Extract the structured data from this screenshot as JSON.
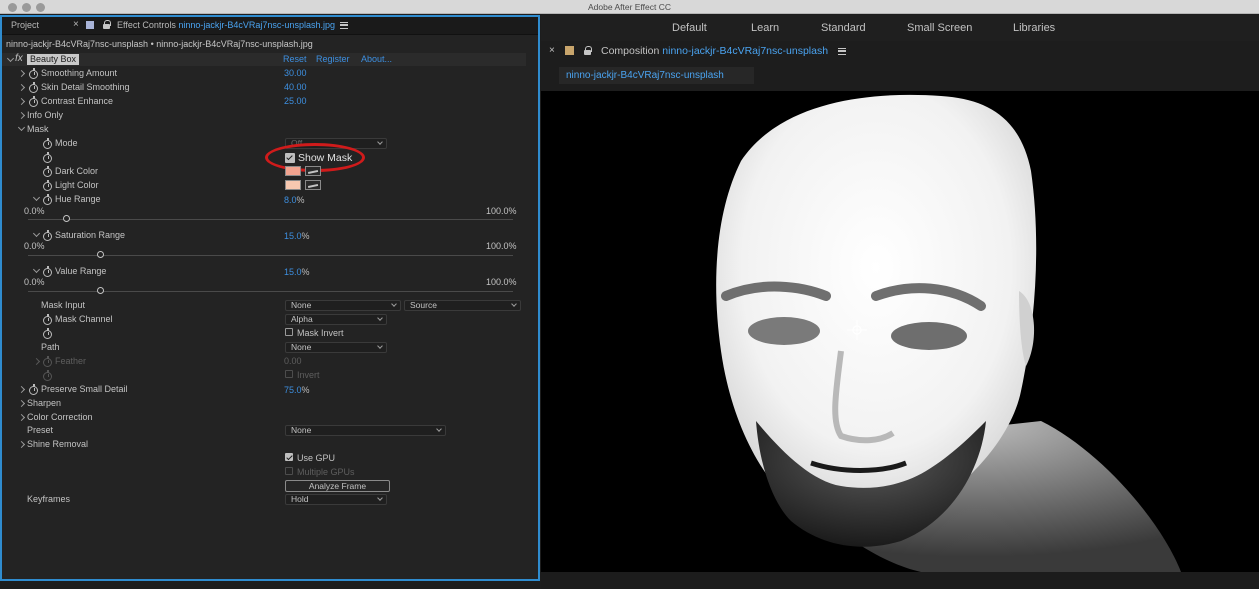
{
  "app": {
    "title": "Adobe After Effect CC"
  },
  "left_tabs": {
    "project": "Project",
    "close_glyph": "×",
    "effect_controls_prefix": "Effect Controls",
    "effect_controls_file": "ninno-jackjr-B4cVRaj7nsc-unsplash.jpg"
  },
  "breadcrumb": "ninno-jackjr-B4cVRaj7nsc-unsplash • ninno-jackjr-B4cVRaj7nsc-unsplash.jpg",
  "effect": {
    "fx_glyph": "fx",
    "name": "Beauty Box",
    "reset": "Reset",
    "register": "Register",
    "about": "About..."
  },
  "props": {
    "smoothing_amount": {
      "label": "Smoothing Amount",
      "value": "30.00"
    },
    "skin_detail": {
      "label": "Skin Detail Smoothing",
      "value": "40.00"
    },
    "contrast": {
      "label": "Contrast Enhance",
      "value": "25.00"
    },
    "info_only": {
      "label": "Info Only"
    },
    "mask": {
      "label": "Mask"
    },
    "mode": {
      "label": "Mode",
      "value": "Off"
    },
    "show_mask": {
      "label": "Show Mask",
      "checked": true
    },
    "dark_color": {
      "label": "Dark Color",
      "color": "#f2a38f"
    },
    "light_color": {
      "label": "Light Color",
      "color": "#f7c8b0"
    },
    "hue_range": {
      "label": "Hue Range",
      "value": "8.0",
      "unit": "%",
      "min": "0.0%",
      "max": "100.0%",
      "level": 0.08
    },
    "saturation_range": {
      "label": "Saturation Range",
      "value": "15.0",
      "unit": "%",
      "min": "0.0%",
      "max": "100.0%",
      "level": 0.15
    },
    "value_range": {
      "label": "Value Range",
      "value": "15.0",
      "unit": "%",
      "min": "0.0%",
      "max": "100.0%",
      "level": 0.15
    },
    "mask_input": {
      "label": "Mask Input",
      "value": "None",
      "source": "Source"
    },
    "mask_channel": {
      "label": "Mask Channel",
      "value": "Alpha"
    },
    "mask_invert": {
      "label": "Mask Invert",
      "checked": false
    },
    "path": {
      "label": "Path",
      "value": "None"
    },
    "feather": {
      "label": "Feather",
      "value": "0.00"
    },
    "invert": {
      "label": "Invert"
    },
    "preserve": {
      "label": "Preserve Small Detail",
      "value": "75.0",
      "unit": "%"
    },
    "sharpen": {
      "label": "Sharpen"
    },
    "color_correction": {
      "label": "Color Correction"
    },
    "preset": {
      "label": "Preset",
      "value": "None"
    },
    "shine_removal": {
      "label": "Shine Removal"
    },
    "use_gpu": {
      "label": "Use GPU",
      "checked": true
    },
    "multiple_gpus": {
      "label": "Multiple GPUs"
    },
    "analyze_frame": {
      "label": "Analyze Frame"
    },
    "keyframes": {
      "label": "Keyframes",
      "value": "Hold"
    }
  },
  "workspaces": [
    "Default",
    "Learn",
    "Standard",
    "Small Screen",
    "Libraries"
  ],
  "composition": {
    "close_glyph": "×",
    "prefix": "Composition",
    "name": "ninno-jackjr-B4cVRaj7nsc-unsplash",
    "tab_label": "ninno-jackjr-B4cVRaj7nsc-unsplash"
  },
  "colors": {
    "accent": "#4aa3f0",
    "panel_border": "#2f8ccf",
    "annotation_ring": "#d01b1b",
    "comp_swatch": "#c8a56c",
    "ec_swatch": "#a9b4d8"
  }
}
